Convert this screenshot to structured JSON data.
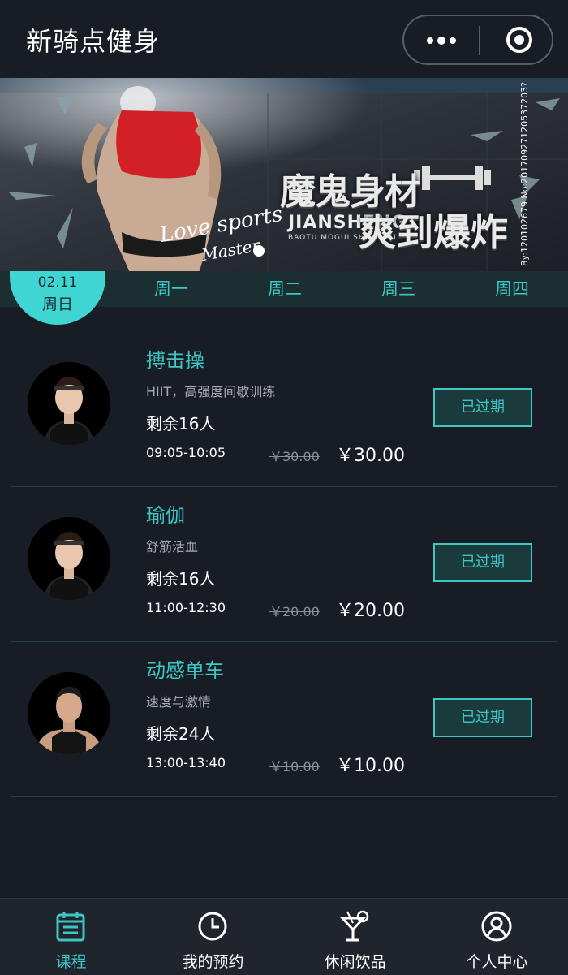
{
  "header": {
    "title": "新骑点健身"
  },
  "banner": {
    "main1": "魔鬼身材",
    "sub1": "JIANSHENG",
    "sub2": "BAOTU MOGUI SHENSCAI",
    "main2": "爽到爆炸",
    "script1": "Love sports",
    "script2": "Master",
    "side": "By:120102679 No:20170927120537203?"
  },
  "days": {
    "active": {
      "date": "02.11",
      "weekday": "周日"
    },
    "tabs": [
      "周一",
      "周二",
      "周三",
      "周四"
    ]
  },
  "courses": [
    {
      "title": "搏击操",
      "desc": "HIIT，高强度间歇训练",
      "remaining": "剩余16人",
      "time": "09:05-10:05",
      "original_price": "￥30.00",
      "price": "￥30.00",
      "status": "已过期"
    },
    {
      "title": "瑜伽",
      "desc": "舒筋活血",
      "remaining": "剩余16人",
      "time": "11:00-12:30",
      "original_price": "￥20.00",
      "price": "￥20.00",
      "status": "已过期"
    },
    {
      "title": "动感单车",
      "desc": "速度与激情",
      "remaining": "剩余24人",
      "time": "13:00-13:40",
      "original_price": "￥10.00",
      "price": "￥10.00",
      "status": "已过期"
    }
  ],
  "nav": [
    {
      "label": "课程",
      "icon": "calendar-icon",
      "active": true
    },
    {
      "label": "我的预约",
      "icon": "clock-icon",
      "active": false
    },
    {
      "label": "休闲饮品",
      "icon": "cocktail-icon",
      "active": false
    },
    {
      "label": "个人中心",
      "icon": "user-icon",
      "active": false
    }
  ],
  "colors": {
    "accent": "#3dc6c4",
    "background": "#181c25",
    "nav_bg": "#20242c"
  }
}
